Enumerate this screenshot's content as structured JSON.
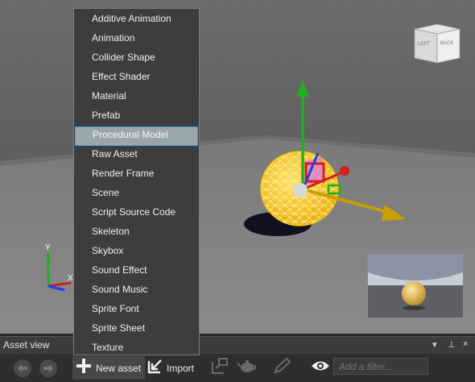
{
  "viewport": {
    "viewcube": {
      "left_label": "LEFT",
      "back_label": "BACK"
    },
    "gizmo_axes": {
      "y_label": "Y",
      "x_label": "X"
    }
  },
  "new_asset_menu": {
    "items": [
      "Additive Animation",
      "Animation",
      "Collider Shape",
      "Effect Shader",
      "Material",
      "Prefab",
      "Procedural Model",
      "Raw Asset",
      "Render Frame",
      "Scene",
      "Script Source Code",
      "Skeleton",
      "Skybox",
      "Sound Effect",
      "Sound Music",
      "Sprite Font",
      "Sprite Sheet",
      "Texture"
    ],
    "highlighted": "Procedural Model"
  },
  "asset_view": {
    "title": "Asset view",
    "controls": {
      "dropdown": "▾",
      "pin": "⊥",
      "close": "×"
    }
  },
  "toolbar": {
    "new_asset_label": "New asset",
    "import_label": "Import",
    "filter_placeholder": "Add a filter...",
    "icons": [
      "back-icon",
      "forward-icon",
      "plus-icon",
      "import-icon",
      "show-in-explorer-icon",
      "teapot-icon",
      "pencil-icon",
      "eye-icon"
    ]
  },
  "colors": {
    "menu_background": "#3d3d3d",
    "menu_highlight": "#9aa6ae",
    "highlight_border": "#4da0d8",
    "x_axis": "#e02020",
    "y_axis": "#20b020",
    "z_axis": "#2040e0",
    "selection_yellow": "#f0b000"
  }
}
